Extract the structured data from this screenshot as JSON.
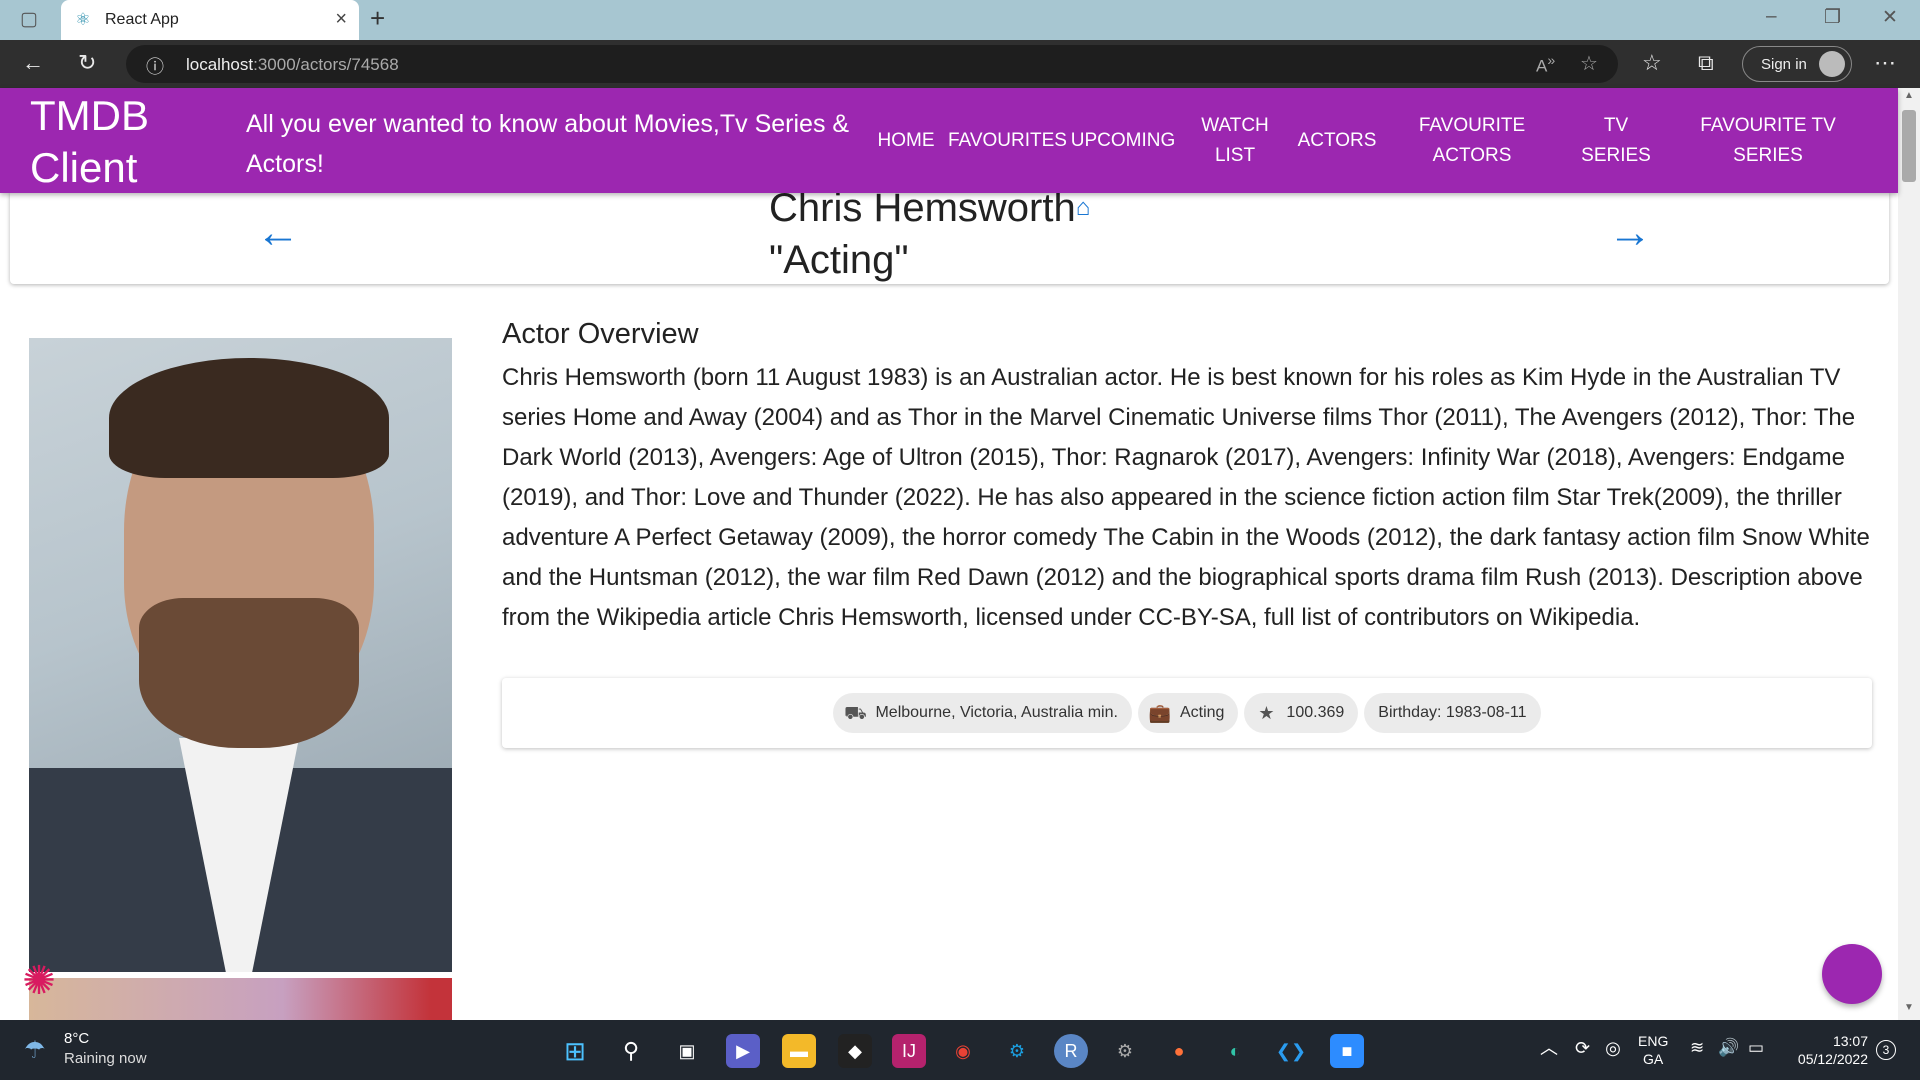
{
  "browser": {
    "tab_title": "React App",
    "url_host": "localhost",
    "url_path": ":3000/actors/74568",
    "sign_in": "Sign in"
  },
  "header": {
    "brand": "TMDB Client",
    "tagline": "All you ever wanted to know about Movies,Tv Series & Actors!",
    "nav": [
      "HOME",
      "FAVOURITES",
      "UPCOMING",
      "WATCH LIST",
      "ACTORS",
      "FAVOURITE ACTORS",
      "TV SERIES",
      "FAVOURITE TV SERIES"
    ]
  },
  "actor": {
    "name": "Chris Hemsworth",
    "department": "\"Acting\"",
    "overview_title": "Actor Overview",
    "overview": "Chris Hemsworth (born 11 August 1983) is an Australian actor. He is best known for his roles as Kim Hyde in the Australian TV series Home and Away (2004) and as Thor in the Marvel Cinematic Universe films Thor (2011), The Avengers (2012), Thor: The Dark World (2013), Avengers: Age of Ultron (2015), Thor: Ragnarok (2017), Avengers: Infinity War (2018), Avengers: Endgame (2019), and Thor: Love and Thunder (2022). He has also appeared in the science fiction action film Star Trek(2009), the thriller adventure A Perfect Getaway (2009), the horror comedy The Cabin in the Woods (2012), the dark fantasy action film Snow White and the Huntsman (2012), the war film Red Dawn (2012) and the biographical sports drama film Rush (2013). Description above from the Wikipedia article Chris Hemsworth, licensed under CC-BY-SA, full list of contributors on Wikipedia.",
    "chips": {
      "birthplace": "Melbourne, Victoria, Australia min.",
      "known_for": "Acting",
      "popularity": "100.369",
      "birthday": "Birthday: 1983-08-11"
    }
  },
  "taskbar": {
    "weather_temp": "8°C",
    "weather_desc": "Raining now",
    "lang_1": "ENG",
    "lang_2": "GA",
    "time": "13:07",
    "date": "05/12/2022",
    "notifications": "3"
  },
  "colors": {
    "primary": "#9c27b0",
    "link": "#1976d2"
  }
}
